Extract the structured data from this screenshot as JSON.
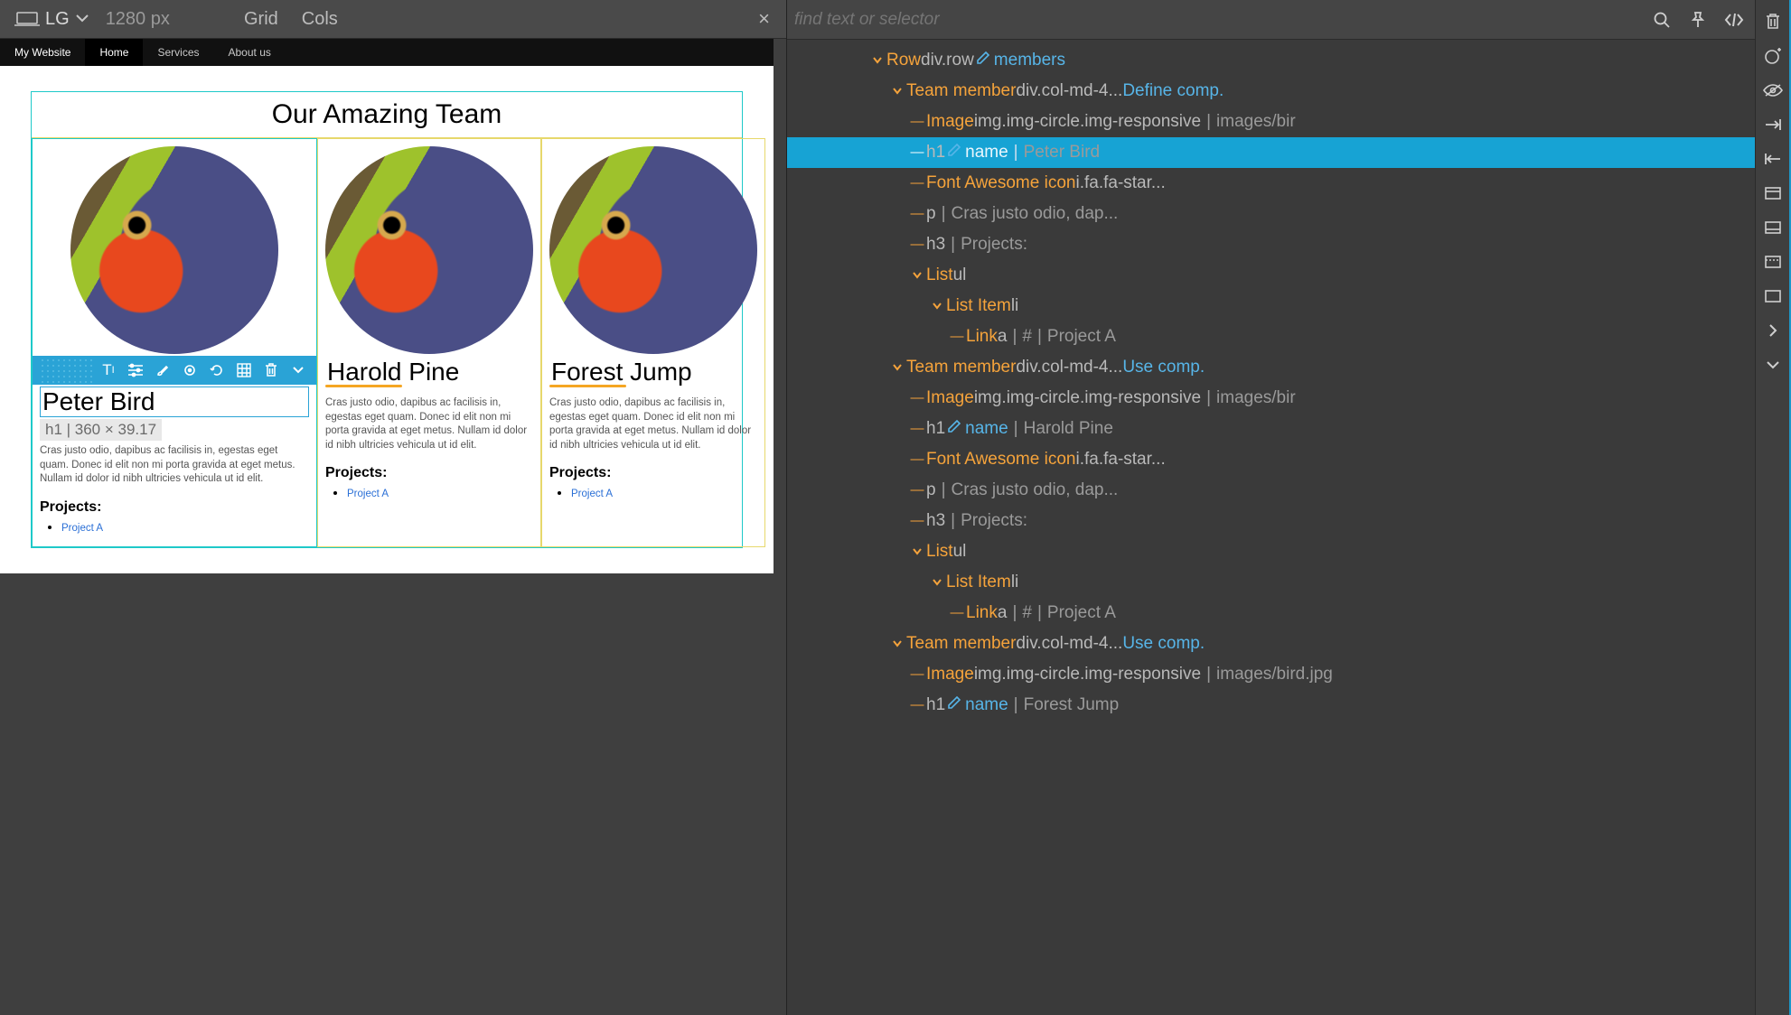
{
  "topbar": {
    "breakpoint_label": "LG",
    "px_label": "1280 px",
    "grid_label": "Grid",
    "cols_label": "Cols"
  },
  "site_nav": {
    "brand": "My Website",
    "items": [
      "Home",
      "Services",
      "About us"
    ],
    "active_index": 0
  },
  "team": {
    "heading": "Our Amazing Team",
    "selected_dim": "h1 | 360 × 39.17",
    "members": [
      {
        "name": "Peter Bird",
        "desc": "Cras justo odio, dapibus ac facilisis in, egestas eget quam. Donec id elit non mi porta gravida at eget metus. Nullam id dolor id nibh ultricies vehicula ut id elit.",
        "projects_h": "Projects:",
        "projects": [
          "Project A"
        ]
      },
      {
        "name": "Harold Pine",
        "desc": "Cras justo odio, dapibus ac facilisis in, egestas eget quam. Donec id elit non mi porta gravida at eget metus. Nullam id dolor id nibh ultricies vehicula ut id elit.",
        "projects_h": "Projects:",
        "projects": [
          "Project A"
        ]
      },
      {
        "name": "Forest Jump",
        "desc": "Cras justo odio, dapibus ac facilisis in, egestas eget quam. Donec id elit non mi porta gravida at eget metus. Nullam id dolor id nibh ultricies vehicula ut id elit.",
        "projects_h": "Projects:",
        "projects": [
          "Project A"
        ]
      }
    ]
  },
  "search": {
    "placeholder": "find text or selector"
  },
  "tree": {
    "rows": [
      {
        "depth": 0,
        "tw": "v",
        "parts": [
          {
            "t": "Row ",
            "c": "orange"
          },
          {
            "t": "div.row",
            "c": "grey"
          },
          {
            "t": "pencil"
          },
          {
            "t": "members",
            "c": "link"
          }
        ]
      },
      {
        "depth": 1,
        "tw": "v",
        "parts": [
          {
            "t": "Team member ",
            "c": "orange"
          },
          {
            "t": "div.col-md-4...",
            "c": "grey"
          },
          {
            "t": "  "
          },
          {
            "t": "Define comp.",
            "c": "link"
          }
        ]
      },
      {
        "depth": 2,
        "tw": "-",
        "parts": [
          {
            "t": "Image ",
            "c": "orange"
          },
          {
            "t": "img.img-circle.img-responsive",
            "c": "grey"
          },
          {
            "t": " | ",
            "c": "pipe"
          },
          {
            "t": "images/bir",
            "c": "faded"
          }
        ]
      },
      {
        "depth": 2,
        "tw": "-",
        "selected": true,
        "arrow": true,
        "parts": [
          {
            "t": "h1",
            "c": "grey"
          },
          {
            "t": "pencil"
          },
          {
            "t": "name",
            "c": "link"
          },
          {
            "t": " | ",
            "c": "pipe"
          },
          {
            "t": "Peter Bird",
            "c": "faded"
          }
        ]
      },
      {
        "depth": 2,
        "tw": "-",
        "parts": [
          {
            "t": "Font Awesome icon ",
            "c": "orange"
          },
          {
            "t": "i.fa.fa-star...",
            "c": "grey"
          }
        ]
      },
      {
        "depth": 2,
        "tw": "-",
        "parts": [
          {
            "t": "p",
            "c": "grey"
          },
          {
            "t": " | ",
            "c": "pipe"
          },
          {
            "t": "Cras justo odio, dap...",
            "c": "faded"
          }
        ]
      },
      {
        "depth": 2,
        "tw": "-",
        "parts": [
          {
            "t": "h3",
            "c": "grey"
          },
          {
            "t": " | ",
            "c": "pipe"
          },
          {
            "t": "Projects:",
            "c": "faded"
          }
        ]
      },
      {
        "depth": 2,
        "tw": "v",
        "parts": [
          {
            "t": "List ",
            "c": "orange"
          },
          {
            "t": "ul",
            "c": "grey"
          }
        ]
      },
      {
        "depth": 3,
        "tw": "v",
        "parts": [
          {
            "t": "List Item ",
            "c": "orange"
          },
          {
            "t": "li",
            "c": "grey"
          }
        ]
      },
      {
        "depth": 4,
        "tw": "-",
        "parts": [
          {
            "t": "Link ",
            "c": "orange"
          },
          {
            "t": "a",
            "c": "grey"
          },
          {
            "t": " | ",
            "c": "pipe"
          },
          {
            "t": "#",
            "c": "faded"
          },
          {
            "t": " | ",
            "c": "pipe"
          },
          {
            "t": "Project A",
            "c": "faded"
          }
        ]
      },
      {
        "depth": 1,
        "tw": "v",
        "parts": [
          {
            "t": "Team member ",
            "c": "orange"
          },
          {
            "t": "div.col-md-4...",
            "c": "grey"
          },
          {
            "t": "  "
          },
          {
            "t": "Use comp.",
            "c": "link"
          }
        ]
      },
      {
        "depth": 2,
        "tw": "-",
        "parts": [
          {
            "t": "Image ",
            "c": "orange"
          },
          {
            "t": "img.img-circle.img-responsive",
            "c": "grey"
          },
          {
            "t": " | ",
            "c": "pipe"
          },
          {
            "t": "images/bir",
            "c": "faded"
          }
        ]
      },
      {
        "depth": 2,
        "tw": "-",
        "arrow": true,
        "parts": [
          {
            "t": "h1",
            "c": "grey"
          },
          {
            "t": "pencil"
          },
          {
            "t": "name",
            "c": "link"
          },
          {
            "t": " | ",
            "c": "pipe"
          },
          {
            "t": "Harold Pine",
            "c": "faded"
          }
        ]
      },
      {
        "depth": 2,
        "tw": "-",
        "parts": [
          {
            "t": "Font Awesome icon ",
            "c": "orange"
          },
          {
            "t": "i.fa.fa-star...",
            "c": "grey"
          }
        ]
      },
      {
        "depth": 2,
        "tw": "-",
        "parts": [
          {
            "t": "p",
            "c": "grey"
          },
          {
            "t": " | ",
            "c": "pipe"
          },
          {
            "t": "Cras justo odio, dap...",
            "c": "faded"
          }
        ]
      },
      {
        "depth": 2,
        "tw": "-",
        "parts": [
          {
            "t": "h3",
            "c": "grey"
          },
          {
            "t": " | ",
            "c": "pipe"
          },
          {
            "t": "Projects:",
            "c": "faded"
          }
        ]
      },
      {
        "depth": 2,
        "tw": "v",
        "parts": [
          {
            "t": "List ",
            "c": "orange"
          },
          {
            "t": "ul",
            "c": "grey"
          }
        ]
      },
      {
        "depth": 3,
        "tw": "v",
        "parts": [
          {
            "t": "List Item ",
            "c": "orange"
          },
          {
            "t": "li",
            "c": "grey"
          }
        ]
      },
      {
        "depth": 4,
        "tw": "-",
        "parts": [
          {
            "t": "Link ",
            "c": "orange"
          },
          {
            "t": "a",
            "c": "grey"
          },
          {
            "t": " | ",
            "c": "pipe"
          },
          {
            "t": "#",
            "c": "faded"
          },
          {
            "t": " | ",
            "c": "pipe"
          },
          {
            "t": "Project A",
            "c": "faded"
          }
        ]
      },
      {
        "depth": 1,
        "tw": "v",
        "parts": [
          {
            "t": "Team member ",
            "c": "orange"
          },
          {
            "t": "div.col-md-4...",
            "c": "grey"
          },
          {
            "t": "  "
          },
          {
            "t": "Use comp.",
            "c": "link"
          }
        ]
      },
      {
        "depth": 2,
        "tw": "-",
        "parts": [
          {
            "t": "Image ",
            "c": "orange"
          },
          {
            "t": "img.img-circle.img-responsive",
            "c": "grey"
          },
          {
            "t": " | ",
            "c": "pipe"
          },
          {
            "t": "images/bird.jpg",
            "c": "faded"
          }
        ]
      },
      {
        "depth": 2,
        "tw": "-",
        "arrow": true,
        "parts": [
          {
            "t": "h1",
            "c": "grey"
          },
          {
            "t": "pencil"
          },
          {
            "t": "name",
            "c": "link"
          },
          {
            "t": " | ",
            "c": "pipe"
          },
          {
            "t": "Forest Jump",
            "c": "faded"
          }
        ]
      }
    ]
  },
  "indent_base": 90,
  "indent_step": 22
}
